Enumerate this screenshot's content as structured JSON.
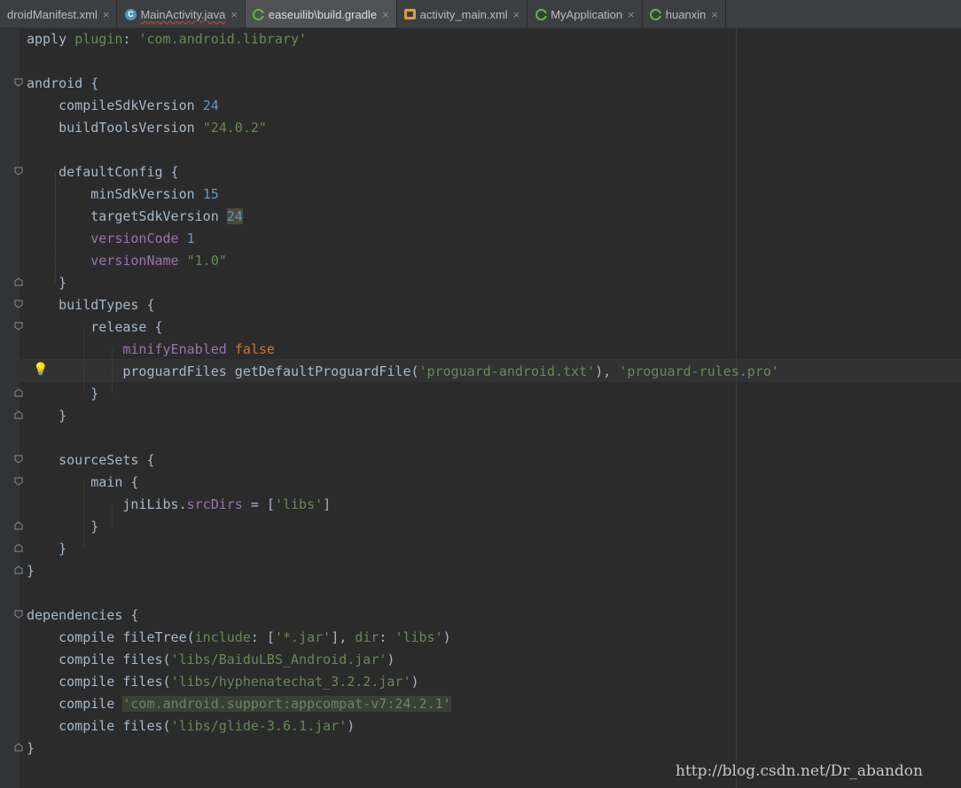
{
  "tabs": [
    {
      "label": "droidManifest.xml",
      "icon": "xml-file-icon"
    },
    {
      "label": "MainActivity.java",
      "icon": "java-class-icon"
    },
    {
      "label": "easeuilib\\build.gradle",
      "icon": "gradle-file-icon",
      "active": true
    },
    {
      "label": "activity_main.xml",
      "icon": "layout-file-icon"
    },
    {
      "label": "MyApplication",
      "icon": "gradle-file-icon"
    },
    {
      "label": "huanxin",
      "icon": "gradle-file-icon"
    }
  ],
  "close_glyph": "×",
  "code": {
    "l1": {
      "a": "apply ",
      "b": "plugin",
      "c": ": ",
      "d": "'com.android.library'"
    },
    "l3": "android {",
    "l4": {
      "a": "    compileSdkVersion ",
      "b": "24"
    },
    "l5": {
      "a": "    buildToolsVersion ",
      "b": "\"24.0.2\""
    },
    "l7": "    defaultConfig {",
    "l8": {
      "a": "        minSdkVersion ",
      "b": "15"
    },
    "l9": {
      "a": "        targetSdkVersion ",
      "b": "24"
    },
    "l10": {
      "a": "        ",
      "b": "versionCode",
      "c": " ",
      "d": "1"
    },
    "l11": {
      "a": "        ",
      "b": "versionName",
      "c": " ",
      "d": "\"1.0\""
    },
    "l12": "    }",
    "l13": "    buildTypes {",
    "l14": "        release {",
    "l15": {
      "a": "            ",
      "b": "minifyEnabled",
      "c": " ",
      "d": "false"
    },
    "l16": {
      "a": "            proguardFiles getDefaultProguardFile(",
      "b": "'proguard-android.txt'",
      "c": "), ",
      "d": "'proguard-rules.pro'"
    },
    "l17": "        }",
    "l18": "    }",
    "l20": "    sourceSets {",
    "l21": "        main {",
    "l22": {
      "a": "            jniLibs.",
      "b": "srcDirs",
      "c": " = [",
      "d": "'libs'",
      "e": "]"
    },
    "l23": "        }",
    "l24": "    }",
    "l25": "}",
    "l27": "dependencies {",
    "l28": {
      "a": "    compile fileTree(",
      "b": "include",
      "c": ": [",
      "d": "'*.jar'",
      "e": "], ",
      "f": "dir",
      "g": ": ",
      "h": "'libs'",
      "i": ")"
    },
    "l29": {
      "a": "    compile files(",
      "b": "'libs/BaiduLBS_Android.jar'",
      "c": ")"
    },
    "l30": {
      "a": "    compile files(",
      "b": "'libs/hyphenatechat_3.2.2.jar'",
      "c": ")"
    },
    "l31": {
      "a": "    compile ",
      "b": "'com.android.support:appcompat-v7:24.2.1'"
    },
    "l32": {
      "a": "    compile files(",
      "b": "'libs/glide-3.6.1.jar'",
      "c": ")"
    },
    "l33": "}"
  },
  "watermark": "http://blog.csdn.net/Dr_abandon"
}
